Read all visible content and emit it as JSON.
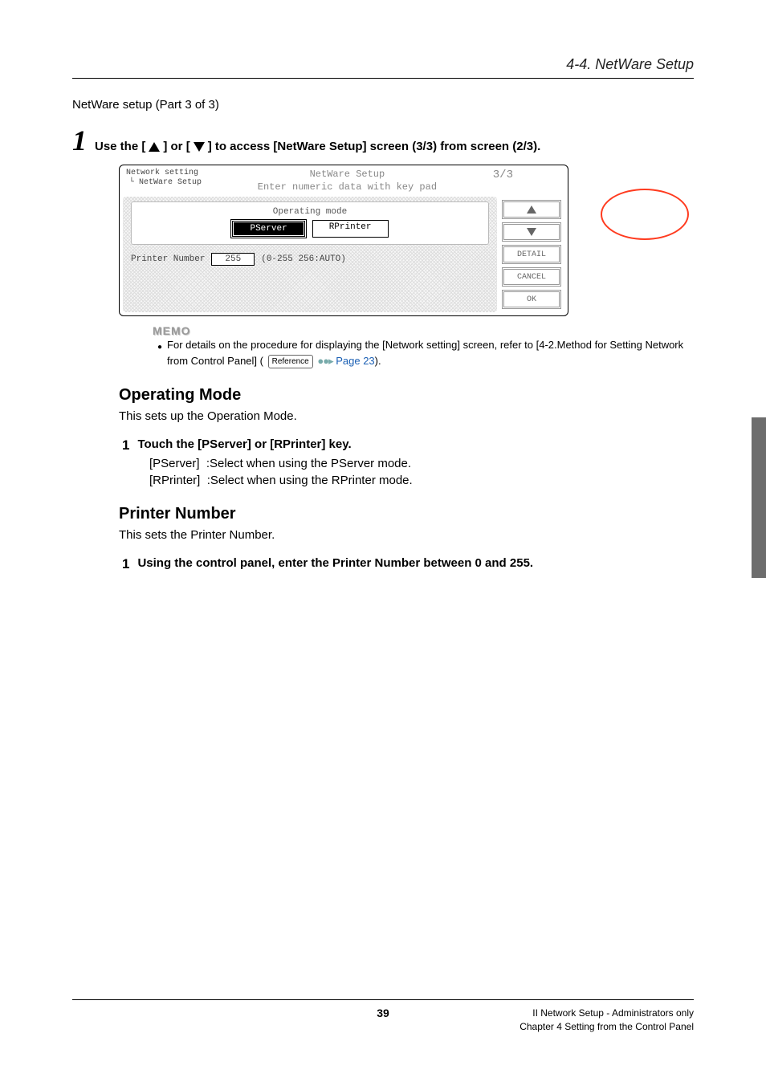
{
  "header": {
    "section_title": "4-4. NetWare Setup"
  },
  "intro": {
    "sub_heading": "NetWare setup (Part 3 of 3)"
  },
  "step1": {
    "number": "1",
    "pre": "Use the [",
    "mid": "] or [",
    "post": "] to access [NetWare Setup] screen (3/3) from screen (2/3)."
  },
  "dialog": {
    "crumb1": "Network setting",
    "crumb2": "NetWare Setup",
    "title": "NetWare Setup",
    "subtitle": "Enter numeric data with key pad",
    "page_ind": "3/3",
    "mode_label": "Operating mode",
    "pserver": "PServer",
    "rprinter": "RPrinter",
    "pn_label": "Printer Number",
    "pn_value": "255",
    "pn_hint": "(0-255 256:AUTO)",
    "btn_detail": "DETAIL",
    "btn_cancel": "CANCEL",
    "btn_ok": "OK"
  },
  "memo": {
    "label": "MEMO",
    "text_a": "For details on the procedure for displaying the [Network setting] screen, refer to [4-2.Method for Setting Network from Control Panel] (",
    "ref": "Reference",
    "text_b": " Page 23",
    "text_c": ")."
  },
  "opmode": {
    "heading": "Operating Mode",
    "desc": "This sets up the Operation Mode.",
    "step_num": "1",
    "step_text": "Touch the [PServer] or [RPrinter] key.",
    "opt1_k": "[PServer]",
    "opt1_v": ":Select when using the PServer mode.",
    "opt2_k": "[RPrinter]",
    "opt2_v": ":Select when using the RPrinter mode."
  },
  "pnum": {
    "heading": "Printer Number",
    "desc": "This sets the Printer Number.",
    "step_num": "1",
    "step_text": "Using the control panel, enter the Printer Number between 0 and 255."
  },
  "footer": {
    "page": "39",
    "line1": "II Network Setup - Administrators only",
    "line2": "Chapter 4 Setting from the Control Panel"
  }
}
